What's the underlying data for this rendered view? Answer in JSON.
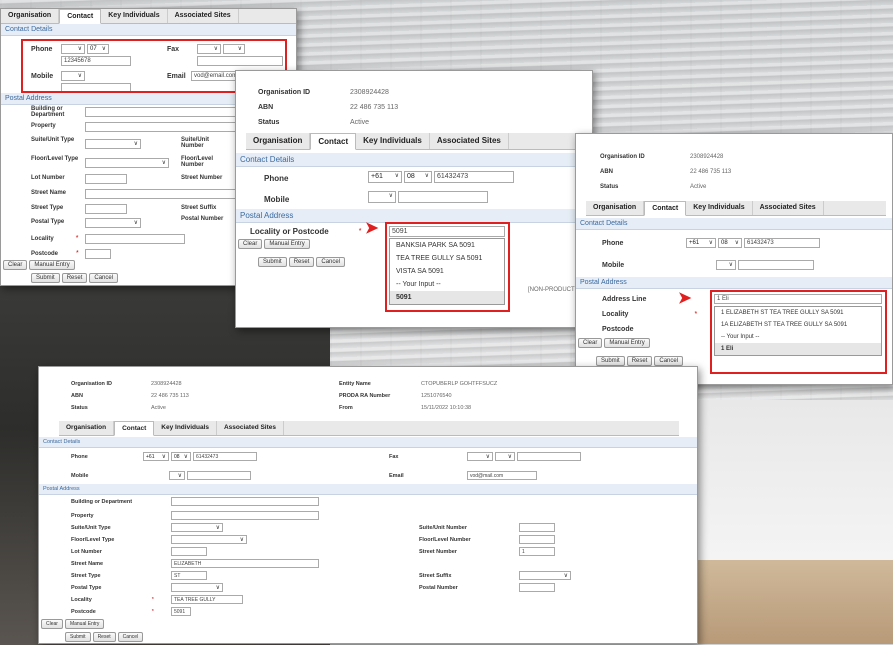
{
  "tabs": [
    "Organisation",
    "Contact",
    "Key Individuals",
    "Associated Sites"
  ],
  "section_contact": "Contact Details",
  "section_postal": "Postal Address",
  "buttons": {
    "clear": "Clear",
    "manual": "Manual Entry",
    "submit": "Submit",
    "reset": "Reset",
    "cancel": "Cancel"
  },
  "labels": {
    "org_id": "Organisation ID",
    "abn": "ABN",
    "status": "Status",
    "phone": "Phone",
    "fax": "Fax",
    "mobile": "Mobile",
    "email": "Email",
    "building": "Building or Department",
    "property": "Property",
    "suite_type": "Suite/Unit Type",
    "suite_number": "Suite/Unit Number",
    "floor_type": "Floor/Level Type",
    "floor_number": "Floor/Level Number",
    "lot": "Lot Number",
    "street_number": "Street Number",
    "street_name": "Street Name",
    "street_type": "Street Type",
    "street_suffix": "Street Suffix",
    "postal_type": "Postal Type",
    "postal_number": "Postal Number",
    "locality": "Locality",
    "postcode": "Postcode",
    "locality_or_postcode": "Locality or Postcode",
    "address_line": "Address Line",
    "entity_name": "Entity Name",
    "proda": "PRODA RA Number",
    "from": "From"
  },
  "org": {
    "id": "2308924428",
    "abn": "22 486 735 113",
    "status": "Active"
  },
  "win1": {
    "phone_code": "07",
    "phone_number": "12345678",
    "email": "vod@email.com"
  },
  "win2": {
    "country": "+61",
    "area": "08",
    "phone": "61432473",
    "query": "5091",
    "suggestions": [
      "BANKSIA PARK SA 5091",
      "TEA TREE GULLY SA 5091",
      "VISTA SA 5091"
    ],
    "your_input": "-- Your Input --",
    "selected": "5091",
    "side_note": "[NON-PRODUCT"
  },
  "win3": {
    "country": "+61",
    "area": "08",
    "phone": "61432473",
    "query": "1 Eli",
    "suggestions": [
      "1 ELIZABETH ST TEA TREE GULLY SA 5091",
      "1A ELIZABETH ST TEA TREE GULLY SA 5091"
    ],
    "your_input": "-- Your Input --",
    "selected": "1 Eli"
  },
  "win4": {
    "entity": "CTOPUBERLP GOHTFFSUCZ",
    "proda": "1251076540",
    "from": "15/11/2022 10:10:38",
    "country": "+61",
    "area": "08",
    "phone": "61432473",
    "email": "vod@mail.com",
    "street_name": "ELIZABETH",
    "street_type": "ST",
    "street_number": "1",
    "locality": "TEA TREE GULLY",
    "postcode": "5091"
  }
}
